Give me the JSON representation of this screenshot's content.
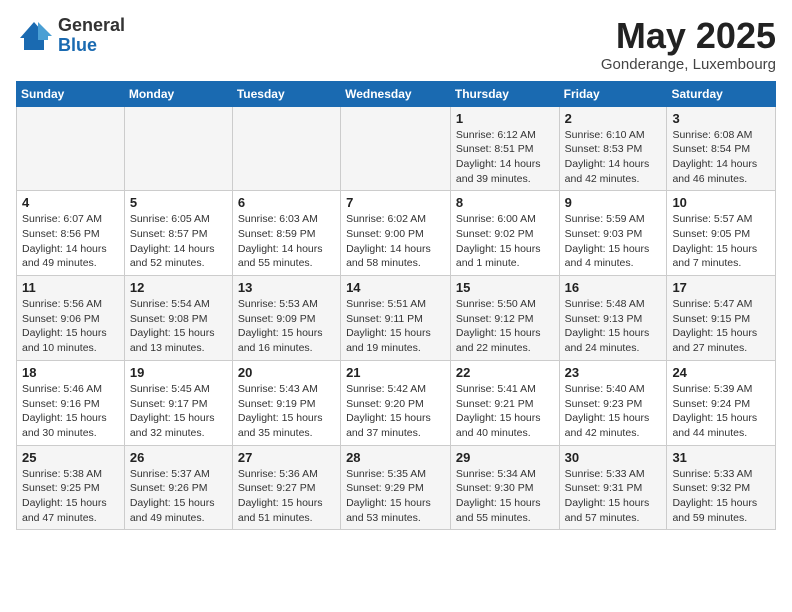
{
  "header": {
    "logo_general": "General",
    "logo_blue": "Blue",
    "title": "May 2025",
    "subtitle": "Gonderange, Luxembourg"
  },
  "days_of_week": [
    "Sunday",
    "Monday",
    "Tuesday",
    "Wednesday",
    "Thursday",
    "Friday",
    "Saturday"
  ],
  "weeks": [
    [
      {
        "num": "",
        "detail": ""
      },
      {
        "num": "",
        "detail": ""
      },
      {
        "num": "",
        "detail": ""
      },
      {
        "num": "",
        "detail": ""
      },
      {
        "num": "1",
        "detail": "Sunrise: 6:12 AM\nSunset: 8:51 PM\nDaylight: 14 hours and 39 minutes."
      },
      {
        "num": "2",
        "detail": "Sunrise: 6:10 AM\nSunset: 8:53 PM\nDaylight: 14 hours and 42 minutes."
      },
      {
        "num": "3",
        "detail": "Sunrise: 6:08 AM\nSunset: 8:54 PM\nDaylight: 14 hours and 46 minutes."
      }
    ],
    [
      {
        "num": "4",
        "detail": "Sunrise: 6:07 AM\nSunset: 8:56 PM\nDaylight: 14 hours and 49 minutes."
      },
      {
        "num": "5",
        "detail": "Sunrise: 6:05 AM\nSunset: 8:57 PM\nDaylight: 14 hours and 52 minutes."
      },
      {
        "num": "6",
        "detail": "Sunrise: 6:03 AM\nSunset: 8:59 PM\nDaylight: 14 hours and 55 minutes."
      },
      {
        "num": "7",
        "detail": "Sunrise: 6:02 AM\nSunset: 9:00 PM\nDaylight: 14 hours and 58 minutes."
      },
      {
        "num": "8",
        "detail": "Sunrise: 6:00 AM\nSunset: 9:02 PM\nDaylight: 15 hours and 1 minute."
      },
      {
        "num": "9",
        "detail": "Sunrise: 5:59 AM\nSunset: 9:03 PM\nDaylight: 15 hours and 4 minutes."
      },
      {
        "num": "10",
        "detail": "Sunrise: 5:57 AM\nSunset: 9:05 PM\nDaylight: 15 hours and 7 minutes."
      }
    ],
    [
      {
        "num": "11",
        "detail": "Sunrise: 5:56 AM\nSunset: 9:06 PM\nDaylight: 15 hours and 10 minutes."
      },
      {
        "num": "12",
        "detail": "Sunrise: 5:54 AM\nSunset: 9:08 PM\nDaylight: 15 hours and 13 minutes."
      },
      {
        "num": "13",
        "detail": "Sunrise: 5:53 AM\nSunset: 9:09 PM\nDaylight: 15 hours and 16 minutes."
      },
      {
        "num": "14",
        "detail": "Sunrise: 5:51 AM\nSunset: 9:11 PM\nDaylight: 15 hours and 19 minutes."
      },
      {
        "num": "15",
        "detail": "Sunrise: 5:50 AM\nSunset: 9:12 PM\nDaylight: 15 hours and 22 minutes."
      },
      {
        "num": "16",
        "detail": "Sunrise: 5:48 AM\nSunset: 9:13 PM\nDaylight: 15 hours and 24 minutes."
      },
      {
        "num": "17",
        "detail": "Sunrise: 5:47 AM\nSunset: 9:15 PM\nDaylight: 15 hours and 27 minutes."
      }
    ],
    [
      {
        "num": "18",
        "detail": "Sunrise: 5:46 AM\nSunset: 9:16 PM\nDaylight: 15 hours and 30 minutes."
      },
      {
        "num": "19",
        "detail": "Sunrise: 5:45 AM\nSunset: 9:17 PM\nDaylight: 15 hours and 32 minutes."
      },
      {
        "num": "20",
        "detail": "Sunrise: 5:43 AM\nSunset: 9:19 PM\nDaylight: 15 hours and 35 minutes."
      },
      {
        "num": "21",
        "detail": "Sunrise: 5:42 AM\nSunset: 9:20 PM\nDaylight: 15 hours and 37 minutes."
      },
      {
        "num": "22",
        "detail": "Sunrise: 5:41 AM\nSunset: 9:21 PM\nDaylight: 15 hours and 40 minutes."
      },
      {
        "num": "23",
        "detail": "Sunrise: 5:40 AM\nSunset: 9:23 PM\nDaylight: 15 hours and 42 minutes."
      },
      {
        "num": "24",
        "detail": "Sunrise: 5:39 AM\nSunset: 9:24 PM\nDaylight: 15 hours and 44 minutes."
      }
    ],
    [
      {
        "num": "25",
        "detail": "Sunrise: 5:38 AM\nSunset: 9:25 PM\nDaylight: 15 hours and 47 minutes."
      },
      {
        "num": "26",
        "detail": "Sunrise: 5:37 AM\nSunset: 9:26 PM\nDaylight: 15 hours and 49 minutes."
      },
      {
        "num": "27",
        "detail": "Sunrise: 5:36 AM\nSunset: 9:27 PM\nDaylight: 15 hours and 51 minutes."
      },
      {
        "num": "28",
        "detail": "Sunrise: 5:35 AM\nSunset: 9:29 PM\nDaylight: 15 hours and 53 minutes."
      },
      {
        "num": "29",
        "detail": "Sunrise: 5:34 AM\nSunset: 9:30 PM\nDaylight: 15 hours and 55 minutes."
      },
      {
        "num": "30",
        "detail": "Sunrise: 5:33 AM\nSunset: 9:31 PM\nDaylight: 15 hours and 57 minutes."
      },
      {
        "num": "31",
        "detail": "Sunrise: 5:33 AM\nSunset: 9:32 PM\nDaylight: 15 hours and 59 minutes."
      }
    ]
  ]
}
